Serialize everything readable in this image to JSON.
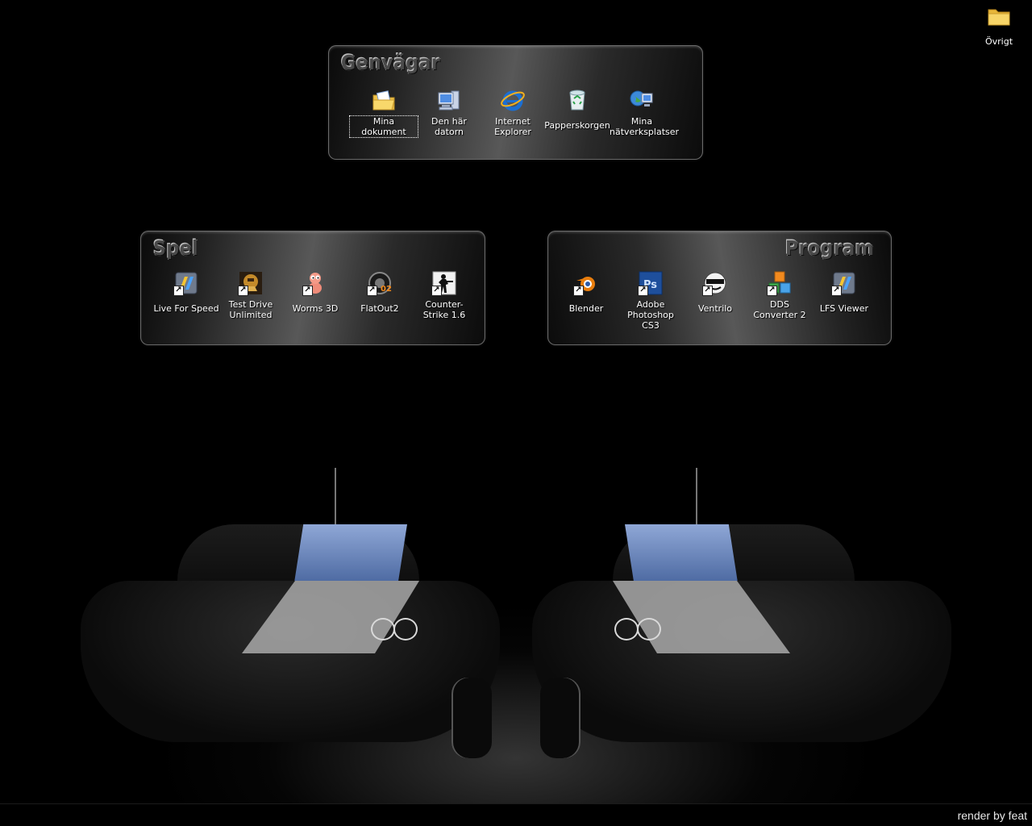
{
  "desktop": {
    "corner_folder": {
      "label": "Övrigt",
      "icon": "folder-icon"
    },
    "credit_text": "render by feat"
  },
  "panels": {
    "genvagar": {
      "title": "Genvägar",
      "items": [
        {
          "label": "Mina dokument",
          "icon": "my-documents-icon",
          "selected": true
        },
        {
          "label": "Den här datorn",
          "icon": "my-computer-icon"
        },
        {
          "label": "Internet Explorer",
          "icon": "internet-explorer-icon"
        },
        {
          "label": "Papperskorgen",
          "icon": "recycle-bin-icon"
        },
        {
          "label": "Mina nätverksplatser",
          "icon": "network-places-icon"
        }
      ]
    },
    "spel": {
      "title": "Spel",
      "items": [
        {
          "label": "Live For Speed",
          "icon": "live-for-speed-icon"
        },
        {
          "label": "Test Drive Unlimited",
          "icon": "test-drive-unlimited-icon"
        },
        {
          "label": "Worms 3D",
          "icon": "worms-3d-icon"
        },
        {
          "label": "FlatOut2",
          "icon": "flatout2-icon"
        },
        {
          "label": "Counter-Strike 1.6",
          "icon": "counter-strike-icon"
        }
      ]
    },
    "program": {
      "title": "Program",
      "items": [
        {
          "label": "Blender",
          "icon": "blender-icon"
        },
        {
          "label": "Adobe Photoshop CS3",
          "icon": "photoshop-icon",
          "badge": "Ps"
        },
        {
          "label": "Ventrilo",
          "icon": "ventrilo-icon"
        },
        {
          "label": "DDS Converter 2",
          "icon": "dds-converter-icon"
        },
        {
          "label": "LFS Viewer",
          "icon": "lfs-viewer-icon"
        }
      ]
    }
  },
  "colors": {
    "background": "#000000",
    "label_text": "#ffffff",
    "ie_blue": "#1c6fd3",
    "photoshop_blue": "#1e4f9c",
    "blender_orange": "#e87d0d",
    "windshield_blue": "#7f9cd2"
  }
}
